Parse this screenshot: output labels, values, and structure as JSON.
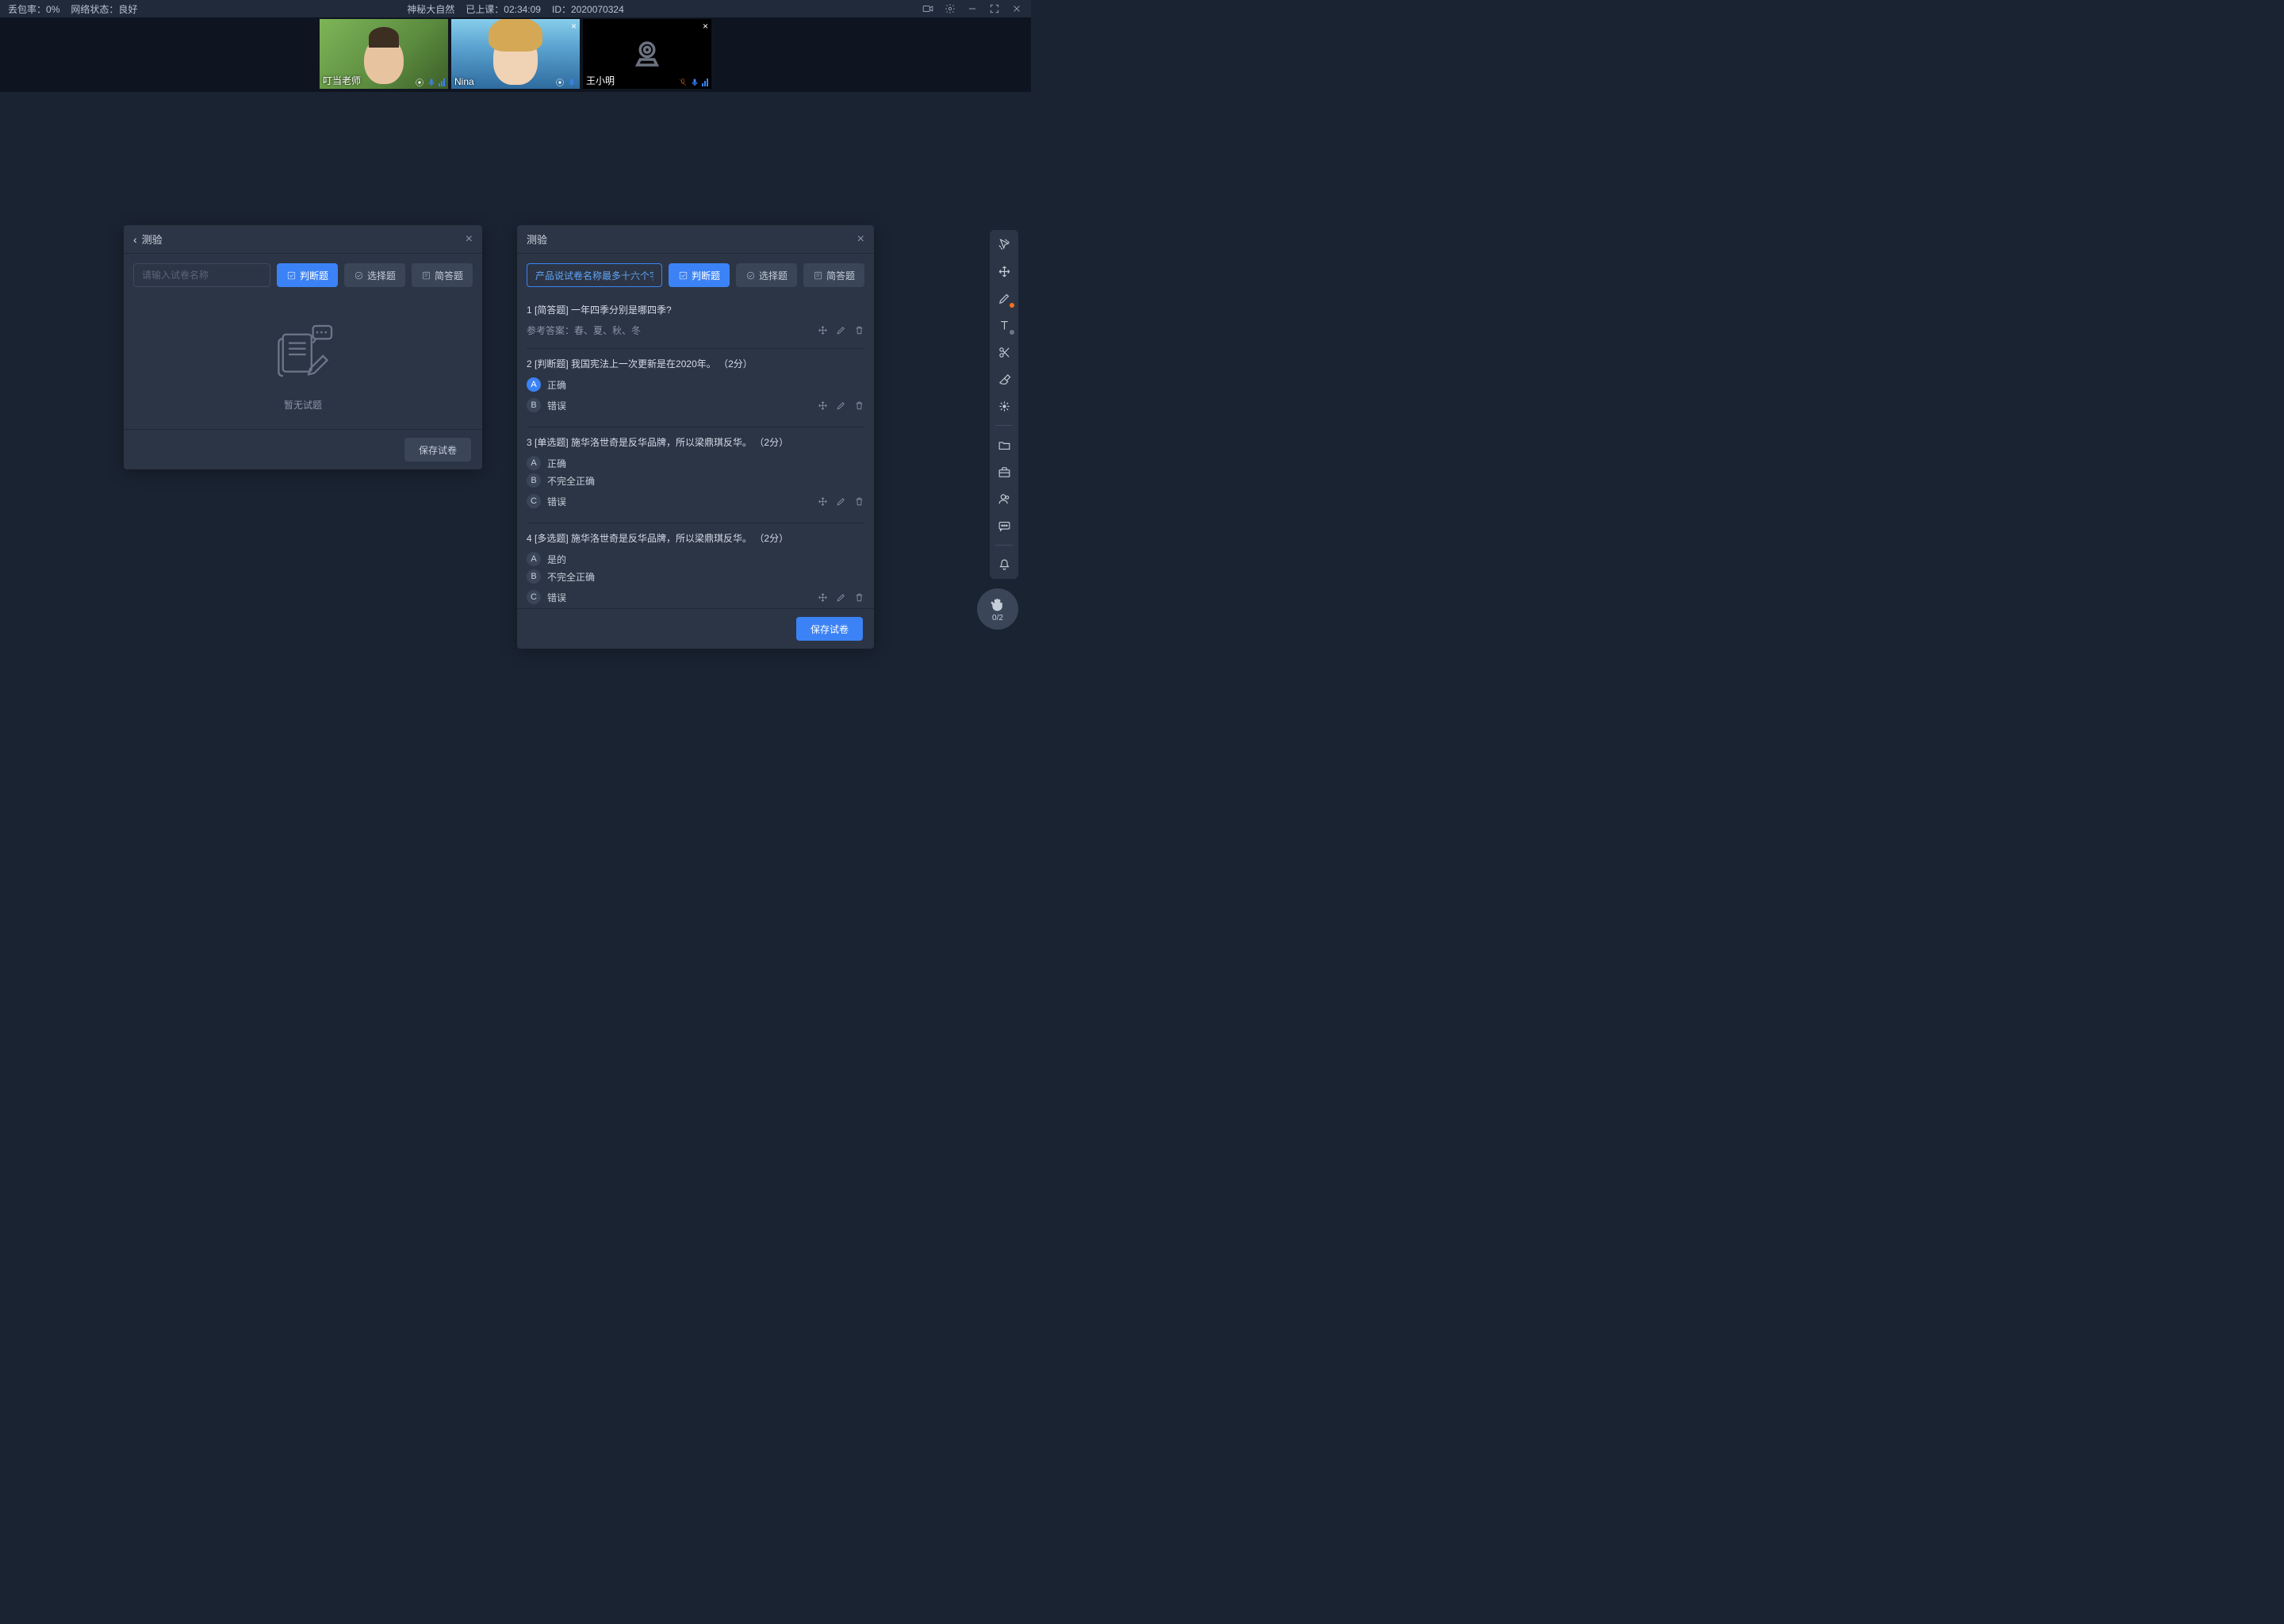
{
  "topbar": {
    "loss_label": "丢包率：",
    "loss_value": "0%",
    "net_label": "网络状态：",
    "net_value": "良好",
    "title": "神秘大自然",
    "elapsed_label": "已上课：",
    "elapsed_value": "02:34:09",
    "id_label": "ID：",
    "id_value": "2020070324"
  },
  "videos": [
    {
      "name": "叮当老师",
      "camera_off": false,
      "closable": false
    },
    {
      "name": "Nina",
      "camera_off": false,
      "closable": true
    },
    {
      "name": "王小明",
      "camera_off": true,
      "closable": true
    }
  ],
  "panel_left": {
    "title": "测验",
    "placeholder": "请输入试卷名称",
    "btn_judge": "判断题",
    "btn_choice": "选择题",
    "btn_short": "简答题",
    "empty_text": "暂无试题",
    "save": "保存试卷"
  },
  "panel_right": {
    "title": "测验",
    "name_value": "产品说试卷名称最多十六个字",
    "btn_judge": "判断题",
    "btn_choice": "选择题",
    "btn_short": "简答题",
    "save": "保存试卷",
    "questions": [
      {
        "num": "1",
        "tag": "[简答题]",
        "text": "一年四季分别是哪四季?",
        "answer_label": "参考答案：",
        "answer": "春、夏、秋、冬"
      },
      {
        "num": "2",
        "tag": "[判断题]",
        "text": "我国宪法上一次更新是在2020年。",
        "score": "（2分）",
        "options": [
          {
            "letter": "A",
            "text": "正确",
            "selected": true
          },
          {
            "letter": "B",
            "text": "错误",
            "selected": false
          }
        ]
      },
      {
        "num": "3",
        "tag": "[单选题]",
        "text": "施华洛世奇是反华品牌，所以梁鼎琪反华。",
        "score": "（2分）",
        "options": [
          {
            "letter": "A",
            "text": "正确",
            "selected": false
          },
          {
            "letter": "B",
            "text": "不完全正确",
            "selected": false
          },
          {
            "letter": "C",
            "text": "错误",
            "selected": false
          }
        ]
      },
      {
        "num": "4",
        "tag": "[多选题]",
        "text": "施华洛世奇是反华品牌，所以梁鼎琪反华。",
        "score": "（2分）",
        "options": [
          {
            "letter": "A",
            "text": "是的",
            "selected": false
          },
          {
            "letter": "B",
            "text": "不完全正确",
            "selected": false
          },
          {
            "letter": "C",
            "text": "错误",
            "selected": false
          }
        ]
      }
    ]
  },
  "hand": {
    "count": "0/2"
  }
}
